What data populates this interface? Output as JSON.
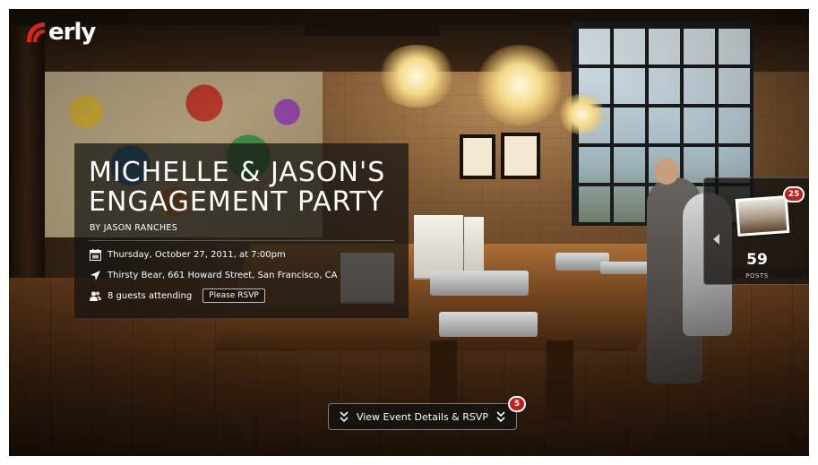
{
  "brand": {
    "name": "erly",
    "accent": "#c0201a"
  },
  "event": {
    "title": "MICHELLE & JASON'S ENGAGEMENT PARTY",
    "byline": "BY JASON RANCHES",
    "date": "Thursday, October 27, 2011, at 7:00pm",
    "location": "Thirsty Bear, 661 Howard Street, San Francisco, CA",
    "guests": "8 guests attending",
    "rsvp_label": "Please RSVP"
  },
  "posts": {
    "count": "59",
    "label": "POSTS",
    "badge": "25"
  },
  "details_button": {
    "label": "View Event Details & RSVP",
    "badge": "5"
  },
  "icons": {
    "logo": "erly-logo-icon",
    "calendar": "calendar-icon",
    "location": "location-arrow-icon",
    "guests": "people-icon",
    "chevron": "chevron-down-double-icon",
    "prev": "chevron-left-icon"
  }
}
